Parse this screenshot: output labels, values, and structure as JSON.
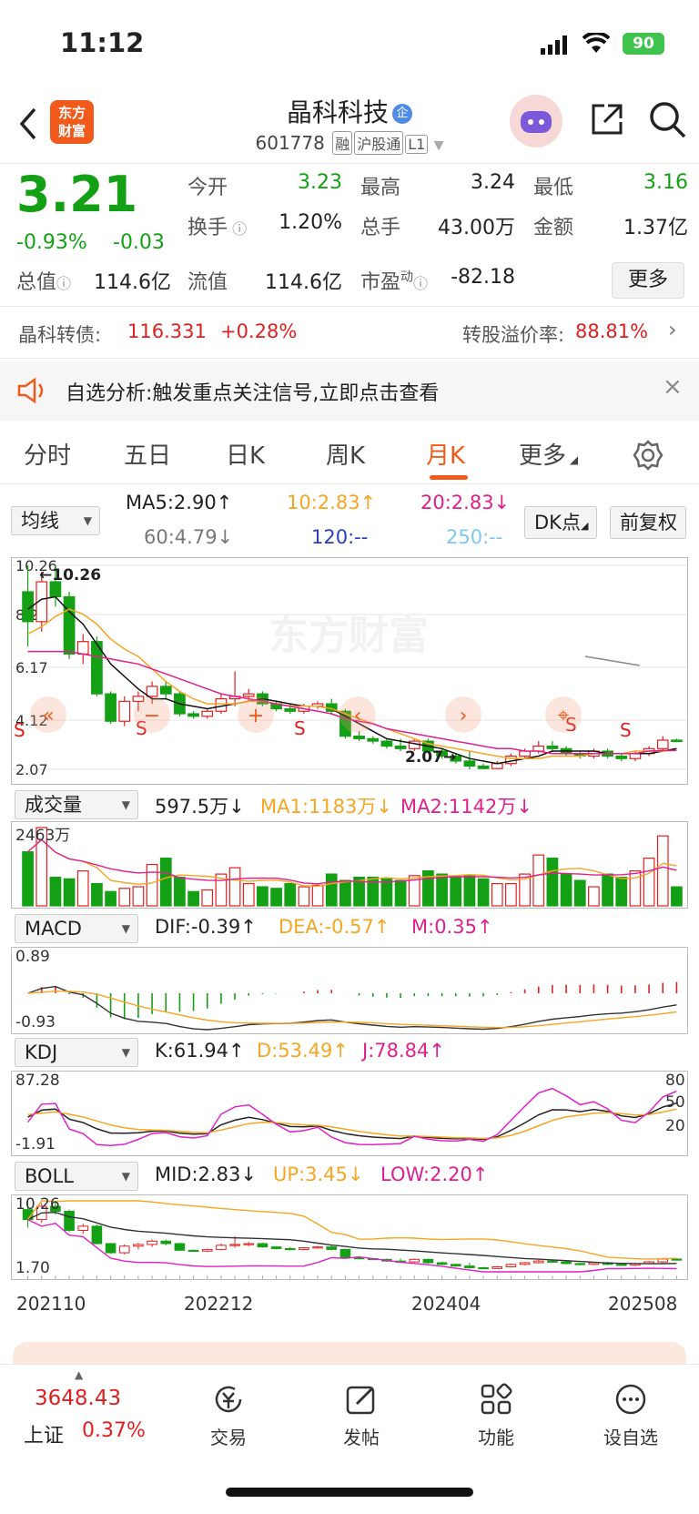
{
  "status_bar": {
    "time": "11:12",
    "battery": "90"
  },
  "header": {
    "logo_text": "东方\n财富",
    "stock_name": "晶科科技",
    "qi_badge": "企",
    "code": "601778",
    "tags": [
      "融",
      "沪股通",
      "L1"
    ]
  },
  "quote": {
    "price": "3.21",
    "change_pct": "-0.93%",
    "change": "-0.03",
    "fields": [
      {
        "label": "今开",
        "value": "3.23",
        "color": "green"
      },
      {
        "label": "最高",
        "value": "3.24",
        "color": "black"
      },
      {
        "label": "最低",
        "value": "3.16",
        "color": "green"
      },
      {
        "label": "换手",
        "value": "1.20%",
        "color": "black"
      },
      {
        "label": "总手",
        "value": "43.00万",
        "color": "black"
      },
      {
        "label": "金额",
        "value": "1.37亿",
        "color": "black"
      },
      {
        "label": "总值",
        "value": "114.6亿",
        "color": "black"
      },
      {
        "label": "流值",
        "value": "114.6亿",
        "color": "black"
      },
      {
        "label": "市盈",
        "sup": "动",
        "value": "-82.18",
        "color": "black"
      }
    ],
    "more_label": "更多"
  },
  "bond": {
    "name": "晶科转债:",
    "price": "116.331",
    "pct": "+0.28%",
    "premium_label": "转股溢价率:",
    "premium": "88.81%"
  },
  "notice": {
    "text": "自选分析:触发重点关注信号,立即点击查看"
  },
  "tabs": {
    "items": [
      "分时",
      "五日",
      "日K",
      "周K",
      "月K",
      "更多"
    ],
    "active": "月K"
  },
  "ma_panel": {
    "selector": "均线",
    "ma5": "MA5:2.90↑",
    "ma10": "10:2.83↑",
    "ma20": "20:2.83↓",
    "ma60": "60:4.79↓",
    "ma120": "120:--",
    "ma250": "250:--",
    "dk": "DK点",
    "adjust": "前复权",
    "y_labels": [
      "10.26",
      "8.22",
      "6.17",
      "4.12",
      "2.07"
    ],
    "high_label": "10.26",
    "low_label": "2.07",
    "watermark": "东方财富",
    "s_marks": [
      "S",
      "S",
      "S",
      "S",
      "S"
    ]
  },
  "volume_panel": {
    "selector": "成交量",
    "vol": "597.5万↓",
    "ma1": "MA1:1183万↓",
    "ma2": "MA2:1142万↓",
    "y_label": "2463万"
  },
  "macd_panel": {
    "selector": "MACD",
    "dif": "DIF:-0.39↑",
    "dea": "DEA:-0.57↑",
    "m": "M:0.35↑",
    "y_top": "0.89",
    "y_bottom": "-0.93"
  },
  "kdj_panel": {
    "selector": "KDJ",
    "k": "K:61.94↑",
    "d": "D:53.49↑",
    "j": "J:78.84↑",
    "y_top": "87.28",
    "y_bottom": "-1.91",
    "right_labels": [
      "80",
      "50",
      "20"
    ]
  },
  "boll_panel": {
    "selector": "BOLL",
    "mid": "MID:2.83↓",
    "up": "UP:3.45↓",
    "low": "LOW:2.20↑",
    "y_top": "10.26",
    "y_bottom": "1.70"
  },
  "x_axis": {
    "labels": [
      "202110",
      "202212",
      "202404",
      "202508"
    ]
  },
  "bottom_bar": {
    "index_value": "3648.43",
    "index_name": "上证",
    "index_pct": "0.37%",
    "items": [
      {
        "label": "交易",
        "icon": "trade-icon"
      },
      {
        "label": "发帖",
        "icon": "post-icon"
      },
      {
        "label": "功能",
        "icon": "function-icon"
      },
      {
        "label": "设自选",
        "icon": "add-watch-icon"
      }
    ]
  },
  "chart_data": {
    "type": "candlestick",
    "period": "monthly",
    "x_labels": [
      "202110",
      "202212",
      "202404",
      "202508"
    ],
    "ylim": [
      2.07,
      10.26
    ],
    "candles": [
      [
        9.2,
        10.26,
        7.0,
        8.0
      ],
      [
        8.0,
        10.0,
        7.6,
        9.6
      ],
      [
        9.6,
        10.26,
        8.6,
        9.0
      ],
      [
        9.0,
        9.2,
        6.5,
        6.7
      ],
      [
        6.7,
        7.5,
        6.3,
        7.2
      ],
      [
        7.2,
        7.4,
        5.0,
        5.1
      ],
      [
        5.1,
        5.2,
        3.9,
        4.0
      ],
      [
        4.0,
        5.0,
        3.8,
        4.8
      ],
      [
        4.8,
        5.2,
        4.4,
        5.0
      ],
      [
        5.0,
        5.6,
        4.7,
        5.4
      ],
      [
        5.4,
        5.6,
        4.9,
        5.1
      ],
      [
        5.1,
        5.2,
        4.2,
        4.3
      ],
      [
        4.3,
        4.4,
        4.1,
        4.2
      ],
      [
        4.2,
        4.5,
        4.1,
        4.4
      ],
      [
        4.4,
        5.1,
        4.3,
        4.9
      ],
      [
        4.9,
        6.0,
        4.6,
        5.0
      ],
      [
        5.0,
        5.3,
        4.8,
        5.1
      ],
      [
        5.1,
        5.2,
        4.6,
        4.7
      ],
      [
        4.7,
        4.8,
        4.4,
        4.5
      ],
      [
        4.5,
        4.7,
        4.3,
        4.4
      ],
      [
        4.4,
        4.7,
        4.3,
        4.6
      ],
      [
        4.6,
        4.8,
        4.5,
        4.7
      ],
      [
        4.7,
        4.9,
        4.3,
        4.4
      ],
      [
        4.4,
        4.5,
        3.3,
        3.4
      ],
      [
        3.4,
        3.6,
        3.2,
        3.3
      ],
      [
        3.3,
        3.4,
        3.1,
        3.2
      ],
      [
        3.2,
        3.3,
        2.9,
        3.0
      ],
      [
        3.0,
        3.3,
        2.8,
        2.9
      ],
      [
        2.9,
        3.3,
        2.8,
        3.2
      ],
      [
        3.2,
        3.3,
        2.7,
        2.8
      ],
      [
        2.8,
        2.9,
        2.5,
        2.6
      ],
      [
        2.6,
        2.7,
        2.3,
        2.4
      ],
      [
        2.4,
        2.8,
        2.07,
        2.2
      ],
      [
        2.2,
        2.3,
        2.07,
        2.1
      ],
      [
        2.1,
        2.4,
        2.07,
        2.3
      ],
      [
        2.3,
        2.7,
        2.2,
        2.6
      ],
      [
        2.6,
        2.9,
        2.5,
        2.8
      ],
      [
        2.8,
        3.2,
        2.7,
        3.0
      ],
      [
        3.0,
        3.2,
        2.8,
        2.9
      ],
      [
        2.9,
        3.0,
        2.6,
        2.7
      ],
      [
        2.7,
        2.8,
        2.5,
        2.6
      ],
      [
        2.6,
        2.9,
        2.5,
        2.8
      ],
      [
        2.8,
        2.9,
        2.5,
        2.6
      ],
      [
        2.6,
        2.7,
        2.4,
        2.5
      ],
      [
        2.5,
        2.8,
        2.4,
        2.7
      ],
      [
        2.7,
        3.0,
        2.6,
        2.9
      ],
      [
        2.9,
        3.4,
        2.8,
        3.24
      ],
      [
        3.24,
        3.3,
        3.16,
        3.21
      ]
    ],
    "volumes": [
      1700,
      2463,
      900,
      850,
      1100,
      700,
      450,
      550,
      600,
      1300,
      1500,
      900,
      450,
      500,
      1000,
      1200,
      700,
      600,
      550,
      700,
      600,
      650,
      1000,
      800,
      900,
      900,
      850,
      800,
      950,
      1100,
      1000,
      900,
      950,
      850,
      700,
      700,
      1000,
      1600,
      1500,
      1000,
      800,
      600,
      1000,
      900,
      1100,
      1500,
      2200,
      597.5
    ],
    "series": [
      {
        "name": "MA5",
        "values": [
          8.5,
          8.9,
          9.0,
          8.4,
          7.9,
          7.1,
          6.3,
          5.8,
          5.3,
          4.9,
          4.9,
          4.7,
          4.6,
          4.5,
          4.6,
          4.7,
          4.8,
          4.9,
          4.8,
          4.7,
          4.6,
          4.6,
          4.5,
          4.2,
          3.9,
          3.6,
          3.3,
          3.2,
          3.1,
          3.0,
          2.9,
          2.7,
          2.5,
          2.4,
          2.3,
          2.4,
          2.5,
          2.6,
          2.8,
          2.8,
          2.8,
          2.8,
          2.7,
          2.7,
          2.7,
          2.7,
          2.8,
          2.9
        ]
      },
      {
        "name": "MA10",
        "values": [
          7.5,
          7.8,
          8.2,
          8.5,
          8.3,
          7.9,
          7.3,
          6.9,
          6.6,
          6.1,
          5.6,
          5.2,
          4.9,
          4.7,
          4.7,
          4.7,
          4.8,
          4.8,
          4.7,
          4.6,
          4.6,
          4.6,
          4.5,
          4.3,
          4.1,
          3.9,
          3.7,
          3.5,
          3.3,
          3.1,
          3.0,
          2.9,
          2.8,
          2.7,
          2.6,
          2.5,
          2.5,
          2.5,
          2.6,
          2.6,
          2.6,
          2.7,
          2.7,
          2.7,
          2.8,
          2.8,
          2.8,
          2.83
        ]
      },
      {
        "name": "MA20",
        "values": [
          6.8,
          6.8,
          6.8,
          6.8,
          6.7,
          6.6,
          6.5,
          6.4,
          6.3,
          6.1,
          5.9,
          5.7,
          5.5,
          5.3,
          5.1,
          5.0,
          4.9,
          4.8,
          4.7,
          4.6,
          4.5,
          4.4,
          4.3,
          4.1,
          4.0,
          3.9,
          3.7,
          3.6,
          3.5,
          3.4,
          3.3,
          3.2,
          3.1,
          3.0,
          2.9,
          2.9,
          2.8,
          2.8,
          2.7,
          2.7,
          2.7,
          2.7,
          2.7,
          2.7,
          2.7,
          2.8,
          2.83,
          2.83
        ]
      }
    ]
  }
}
